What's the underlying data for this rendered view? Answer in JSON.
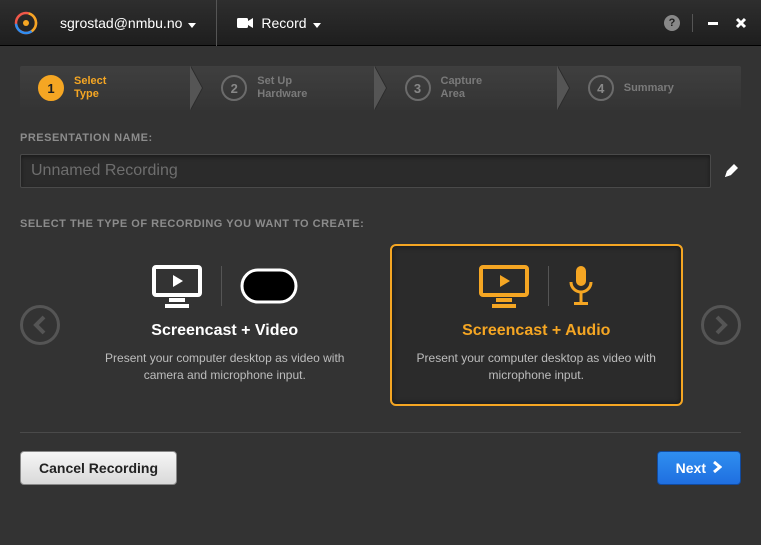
{
  "topbar": {
    "user": "sgrostad@nmbu.no",
    "record_label": "Record"
  },
  "stepper": {
    "steps": [
      {
        "num": "1",
        "label": "Select\nType",
        "active": true
      },
      {
        "num": "2",
        "label": "Set Up\nHardware",
        "active": false
      },
      {
        "num": "3",
        "label": "Capture\nArea",
        "active": false
      },
      {
        "num": "4",
        "label": "Summary",
        "active": false
      }
    ]
  },
  "presentation_name_label": "PRESENTATION NAME:",
  "presentation_name_value": "Unnamed Recording",
  "select_type_label": "SELECT THE TYPE OF RECORDING YOU WANT TO CREATE:",
  "options": [
    {
      "title": "Screencast + Video",
      "desc": "Present your computer desktop as video with camera and microphone input.",
      "selected": false,
      "icons": [
        "monitor",
        "camera"
      ]
    },
    {
      "title": "Screencast + Audio",
      "desc": "Present your computer desktop as video with microphone input.",
      "selected": true,
      "icons": [
        "monitor",
        "mic"
      ]
    }
  ],
  "footer": {
    "cancel_label": "Cancel Recording",
    "next_label": "Next"
  }
}
